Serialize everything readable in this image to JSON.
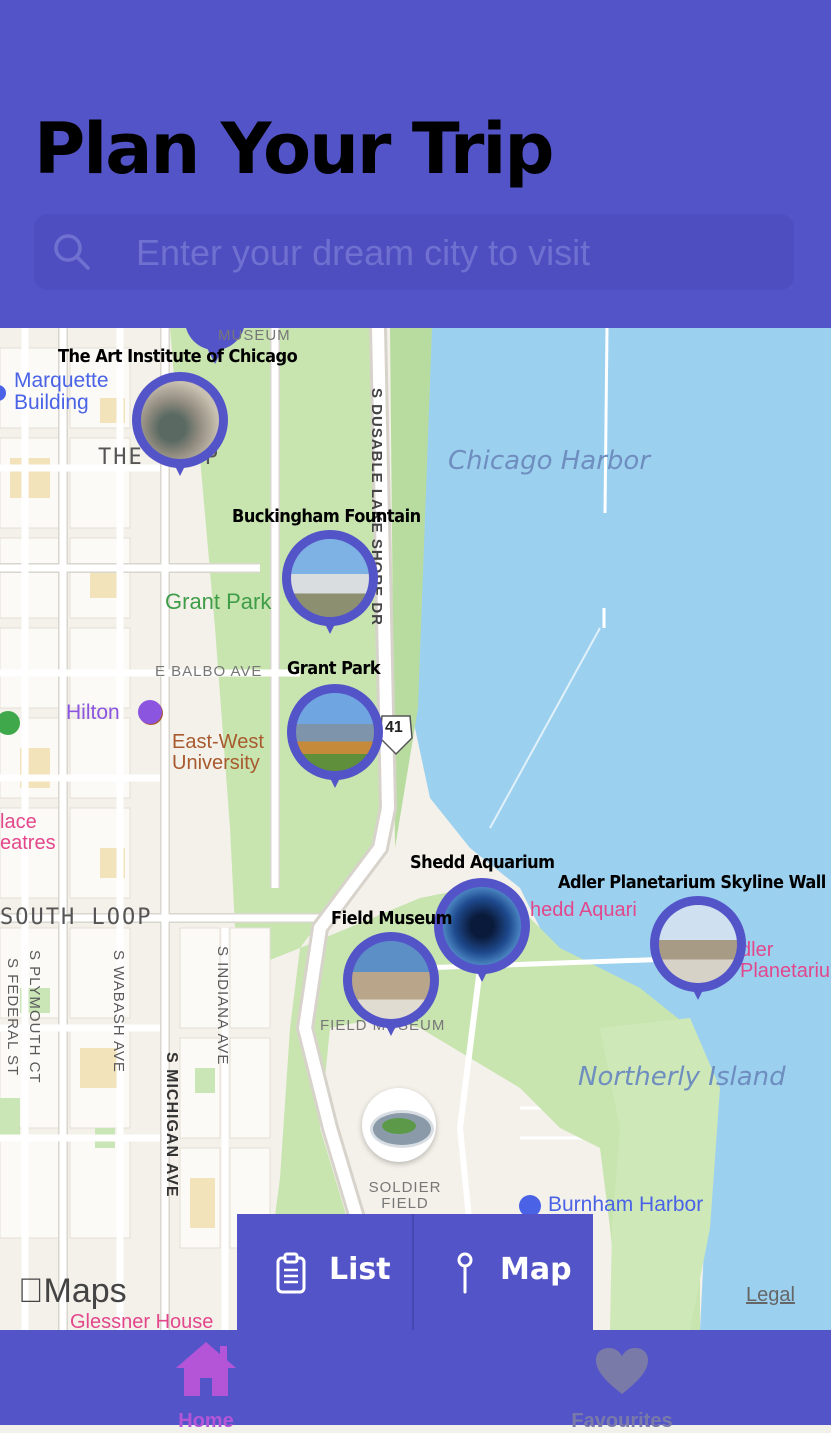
{
  "header": {
    "title": "Plan Your Trip",
    "search_placeholder": "Enter your dream city to visit"
  },
  "map": {
    "area_labels": {
      "chicago_harbor": "Chicago Harbor",
      "northerly_island": "Northerly Island",
      "grant_park": "Grant Park",
      "the_loop": "THE LOOP",
      "south_loop": "SOUTH LOOP",
      "marquette": "Marquette Building",
      "hilton": "Hilton",
      "east_west": "East-West University",
      "palace": "lace eatres",
      "shedd_underlay": "hedd Aquari",
      "adler_underlay": "dler Planetariu",
      "field_museum_underlay": "FIELD MUSEUM",
      "soldier_field": "SOLDIER FIELD",
      "burnham_harbor": "Burnham Harbor",
      "glessner": "Glessner House",
      "museum_top": "MUSEUM"
    },
    "streets": {
      "lake_shore": "S DUSABLE LAKE SHORE DR",
      "balbo": "E BALBO AVE",
      "michigan": "S MICHIGAN AVE",
      "wabash": "S WABASH AVE",
      "indiana": "S INDIANA AVE",
      "plymouth": "S PLYMOUTH CT",
      "federal": "S FEDERAL ST",
      "route_shield": "41"
    },
    "pins": [
      {
        "name": "The Art Institute of Chicago"
      },
      {
        "name": "Buckingham Fountain"
      },
      {
        "name": "Grant Park"
      },
      {
        "name": "Shedd Aquarium"
      },
      {
        "name": "Adler Planetarium Skyline Wall"
      },
      {
        "name": "Field Museum"
      }
    ],
    "attribution": "Maps",
    "legal": "Legal"
  },
  "view_toggle": {
    "list_label": "List",
    "map_label": "Map"
  },
  "tabbar": {
    "home_label": "Home",
    "favourites_label": "Favourites",
    "active_color": "#b455d8",
    "inactive_color": "#7a7aa8"
  },
  "colors": {
    "brand": "#5454c9",
    "water": "#9cd0ef",
    "park": "#c8e5b0"
  }
}
